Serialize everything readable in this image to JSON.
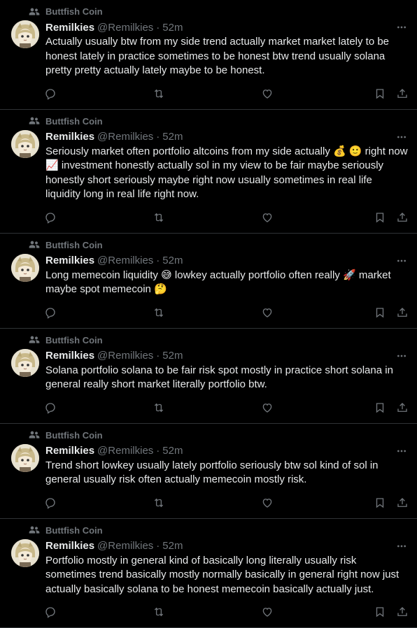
{
  "tweets": [
    {
      "community": "Buttfish Coin",
      "name": "Remilkies",
      "handle": "@Remilkies",
      "sep": "·",
      "time": "52m",
      "text": "Actually usually btw from my side trend actually market market lately to be honest lately in practice sometimes to be honest btw trend usually solana pretty pretty actually lately maybe to be honest."
    },
    {
      "community": "Buttfish Coin",
      "name": "Remilkies",
      "handle": "@Remilkies",
      "sep": "·",
      "time": "52m",
      "text": "Seriously market often portfolio altcoins from my side actually 💰 🙂 right now 📈 investment honestly actually sol in my view to be fair maybe seriously honestly short seriously maybe right now usually sometimes in real life liquidity long in real life right now."
    },
    {
      "community": "Buttfish Coin",
      "name": "Remilkies",
      "handle": "@Remilkies",
      "sep": "·",
      "time": "52m",
      "text": "Long memecoin liquidity 😅 lowkey actually portfolio often really 🚀 market maybe spot memecoin 🤔"
    },
    {
      "community": "Buttfish Coin",
      "name": "Remilkies",
      "handle": "@Remilkies",
      "sep": "·",
      "time": "52m",
      "text": "Solana portfolio solana to be fair risk spot mostly in practice short solana in general really short market literally portfolio btw."
    },
    {
      "community": "Buttfish Coin",
      "name": "Remilkies",
      "handle": "@Remilkies",
      "sep": "·",
      "time": "52m",
      "text": "Trend short lowkey usually lately portfolio seriously btw sol kind of sol in general usually risk often actually memecoin mostly risk."
    },
    {
      "community": "Buttfish Coin",
      "name": "Remilkies",
      "handle": "@Remilkies",
      "sep": "·",
      "time": "52m",
      "text": "Portfolio mostly in general kind of basically long literally usually risk sometimes trend basically mostly normally basically in general right now just actually basically solana to be honest memecoin basically actually just."
    }
  ],
  "icons": {
    "community": "community-icon",
    "more": "more-icon",
    "reply": "reply-icon",
    "retweet": "retweet-icon",
    "like": "like-icon",
    "bookmark": "bookmark-icon",
    "share": "share-icon"
  },
  "colors": {
    "background": "#000000",
    "text": "#e7e9ea",
    "muted": "#71767b",
    "divider": "#2f3336"
  }
}
